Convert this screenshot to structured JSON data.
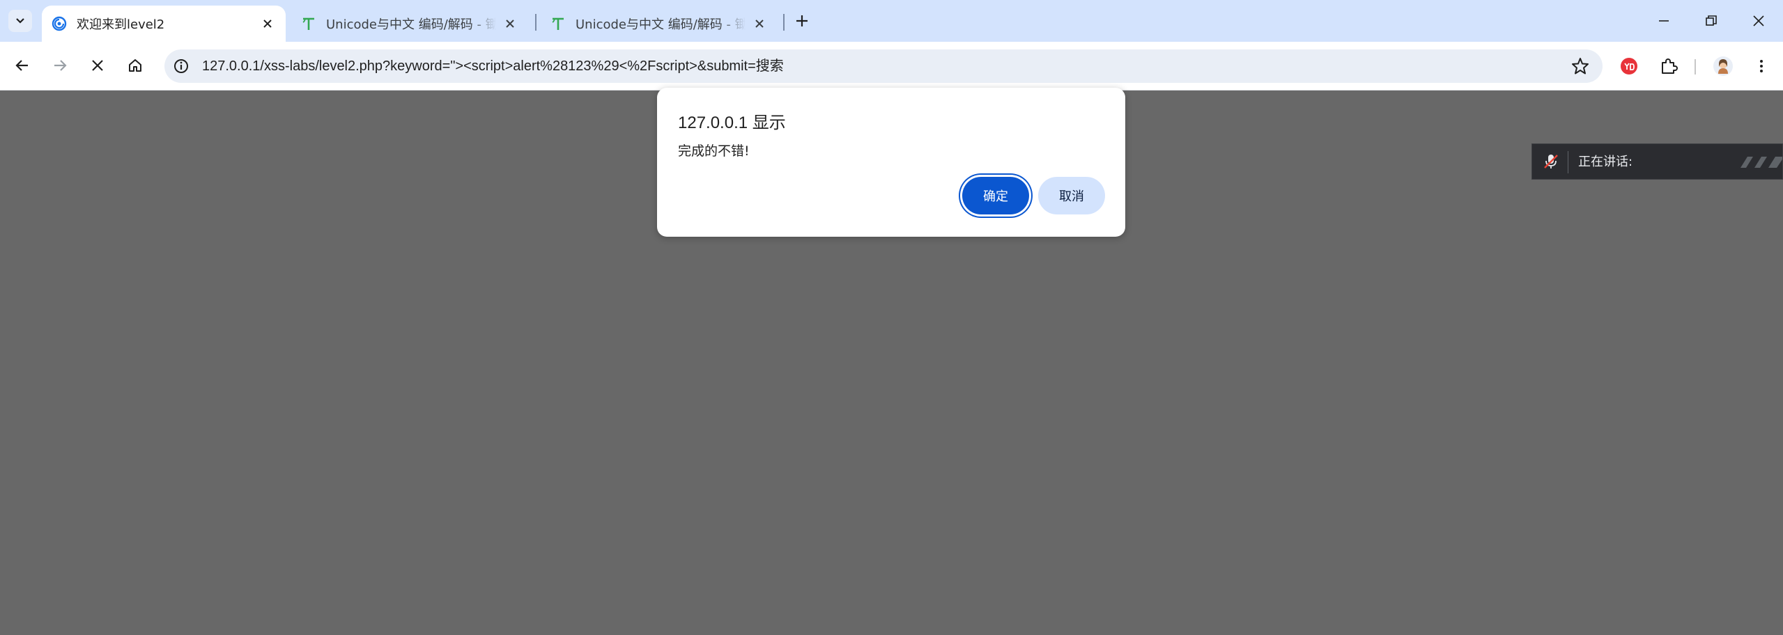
{
  "browser": {
    "tabs": [
      {
        "title": "欢迎来到level2",
        "favicon": "spiral-icon",
        "active": true
      },
      {
        "title": "Unicode与中文 编码/解码 - 锄",
        "favicon": "t-logo-icon",
        "active": false
      },
      {
        "title": "Unicode与中文 编码/解码 - 锄",
        "favicon": "t-logo-icon",
        "active": false
      }
    ],
    "address": {
      "url": "127.0.0.1/xss-labs/level2.php?keyword=\"><script>alert%28123%29<%2Fscript>&submit=搜索"
    },
    "extensions": [
      "youdao-icon",
      "puzzle-icon",
      "profile-avatar"
    ]
  },
  "alert_dialog": {
    "title": "127.0.0.1 显示",
    "message": "完成的不错!",
    "ok_label": "确定",
    "cancel_label": "取消"
  },
  "speaking_bar": {
    "label": "正在讲话:"
  },
  "colors": {
    "titlebar": "#d3e3fd",
    "accent": "#0b57d0",
    "overlay": "#686868"
  }
}
